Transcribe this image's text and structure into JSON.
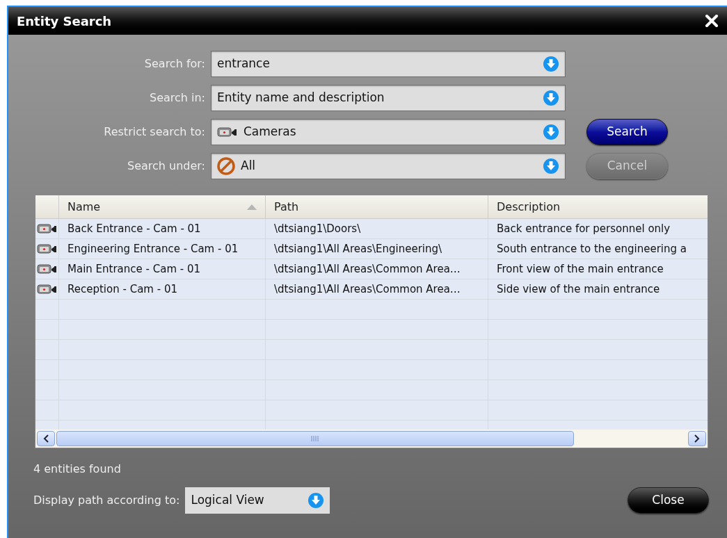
{
  "window": {
    "title": "Entity Search"
  },
  "form": [
    {
      "label": "Search for:",
      "value": "entrance",
      "kind": "plain"
    },
    {
      "label": "Search in:",
      "value": "Entity name and description",
      "kind": "plain"
    },
    {
      "label": "Restrict search to:",
      "value": "Cameras",
      "kind": "camera"
    },
    {
      "label": "Search under:",
      "value": "All",
      "kind": "scope"
    }
  ],
  "buttons": [
    {
      "label": "Search",
      "kind": "primary",
      "disabled": false
    },
    {
      "label": "Cancel",
      "kind": "primary",
      "disabled": true
    }
  ],
  "table": {
    "columns": [
      {
        "label": "Name",
        "sorted": true
      },
      {
        "label": "Path",
        "sorted": false
      },
      {
        "label": "Description",
        "sorted": false
      }
    ],
    "rows": [
      [
        "Back Entrance - Cam - 01",
        "\\dtsiang1\\Doors\\",
        "Back entrance for personnel only"
      ],
      [
        "Engineering Entrance - Cam - 01",
        "\\dtsiang1\\All Areas\\Engineering\\",
        "South entrance to the engineering a"
      ],
      [
        "Main Entrance - Cam - 01",
        "\\dtsiang1\\All Areas\\Common Area…",
        "Front view of the main entrance"
      ],
      [
        "Reception - Cam - 01",
        "\\dtsiang1\\All Areas\\Common Area…",
        "Side view of the main entrance"
      ]
    ]
  },
  "status": "4 entities found",
  "display_path": {
    "label": "Display path according to:",
    "value": "Logical View"
  },
  "close_button": {
    "label": "Close"
  }
}
